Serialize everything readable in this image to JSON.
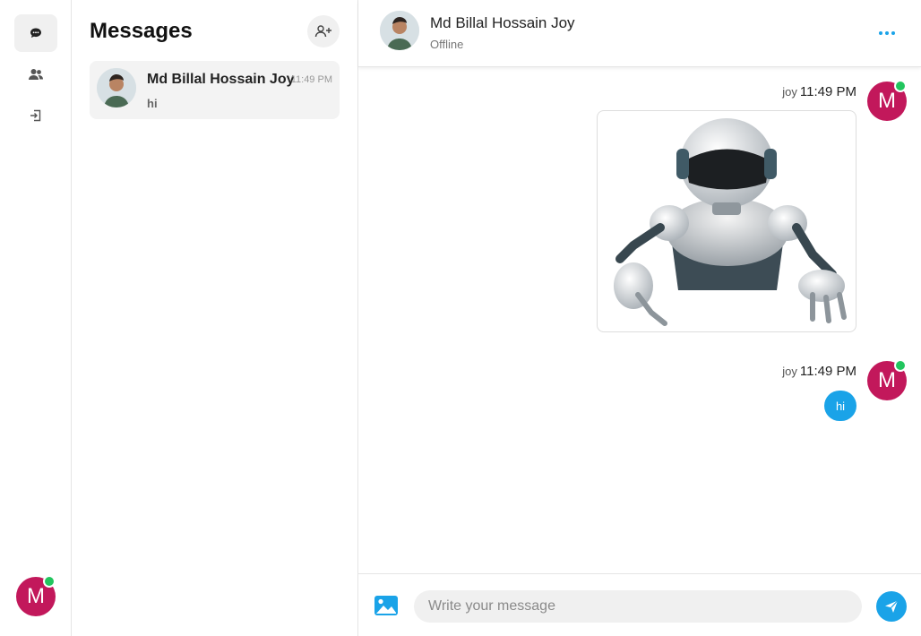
{
  "rail": {
    "items": [
      {
        "icon": "chat-icon",
        "active": true
      },
      {
        "icon": "users-icon",
        "active": false
      },
      {
        "icon": "logout-icon",
        "active": false
      }
    ],
    "user_initial": "M"
  },
  "conversations": {
    "title": "Messages",
    "add_icon": "add-user-icon",
    "items": [
      {
        "name": "Md Billal Hossain Joy",
        "time": "11:49 PM",
        "last_message": "hi"
      }
    ]
  },
  "chat": {
    "contact_name": "Md Billal Hossain Joy",
    "contact_status": "Offline",
    "messages": [
      {
        "sender": "joy",
        "time": "11:49 PM",
        "type": "image",
        "avatar_initial": "M"
      },
      {
        "sender": "joy",
        "time": "11:49 PM",
        "type": "text",
        "text": "hi",
        "avatar_initial": "M"
      }
    ],
    "input_placeholder": "Write your message",
    "input_value": ""
  },
  "colors": {
    "accent": "#1aa3e8",
    "avatar": "#c2185b",
    "online": "#22c55e"
  }
}
